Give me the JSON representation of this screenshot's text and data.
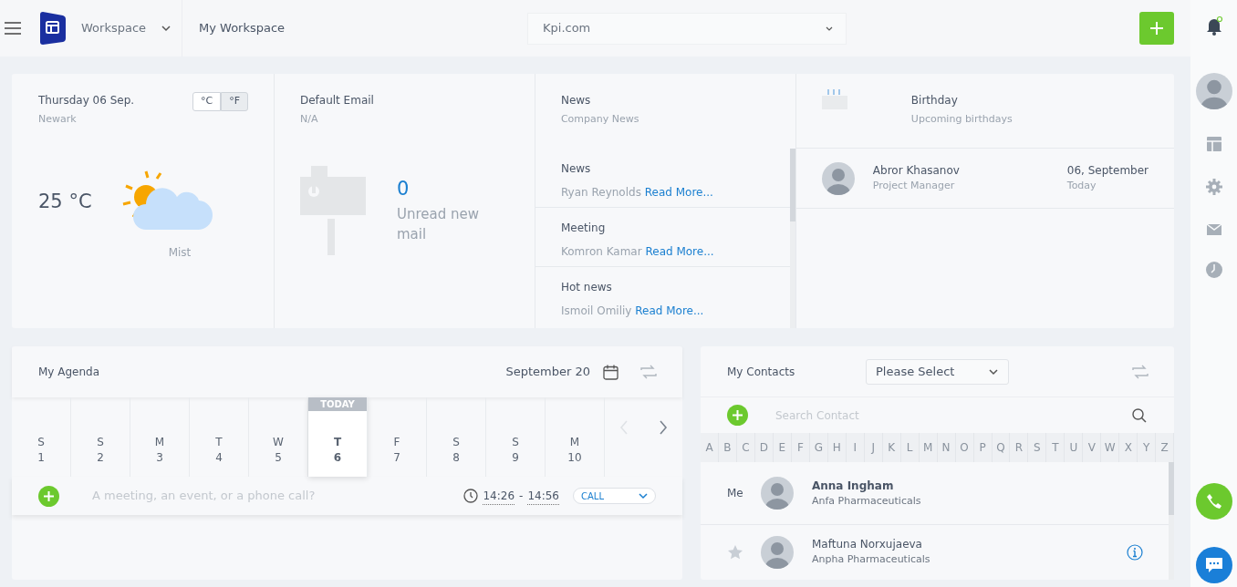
{
  "header": {
    "workspace": "Workspace",
    "page_title": "My Workspace",
    "domain": "Kpi.com"
  },
  "weather": {
    "date": "Thursday 06 Sep.",
    "city": "Newark",
    "units": [
      {
        "label": "°C",
        "selected": false
      },
      {
        "label": "°F",
        "selected": true
      }
    ],
    "temperature": "25 °C",
    "condition": "Mist"
  },
  "email": {
    "title": "Default Email",
    "address": "N/A",
    "count": "0",
    "caption": "Unread new mail"
  },
  "news": {
    "title": "News",
    "subtitle": "Company News",
    "items": [
      {
        "title": "News",
        "author": "Ryan Reynolds",
        "link": "Read More..."
      },
      {
        "title": "Meeting",
        "author": "Komron Kamar",
        "link": "Read More..."
      },
      {
        "title": "Hot news",
        "author": "Ismoil Omiliy",
        "link": "Read More..."
      }
    ]
  },
  "birthday": {
    "title": "Birthday",
    "subtitle": "Upcoming birthdays",
    "people": [
      {
        "name": "Abror Khasanov",
        "role": "Project Manager",
        "date": "06, September",
        "when": "Today"
      }
    ]
  },
  "agenda": {
    "title": "My Agenda",
    "month": "September 20",
    "today_label": "TODAY",
    "days": [
      {
        "weekday": "S",
        "day": "1",
        "selected": false
      },
      {
        "weekday": "S",
        "day": "2",
        "selected": false
      },
      {
        "weekday": "M",
        "day": "3",
        "selected": false
      },
      {
        "weekday": "T",
        "day": "4",
        "selected": false
      },
      {
        "weekday": "W",
        "day": "5",
        "selected": false
      },
      {
        "weekday": "T",
        "day": "6",
        "selected": true
      },
      {
        "weekday": "F",
        "day": "7",
        "selected": false
      },
      {
        "weekday": "S",
        "day": "8",
        "selected": false
      },
      {
        "weekday": "S",
        "day": "9",
        "selected": false
      },
      {
        "weekday": "M",
        "day": "10",
        "selected": false
      }
    ],
    "placeholder": "A meeting, an event, or a phone call?",
    "time_from": "14:26",
    "time_separator": "-",
    "time_to": "14:56",
    "type": "CALL"
  },
  "contacts": {
    "title": "My Contacts",
    "filter": "Please Select",
    "search_placeholder": "Search Contact",
    "letters": [
      "A",
      "B",
      "C",
      "D",
      "E",
      "F",
      "G",
      "H",
      "I",
      "J",
      "K",
      "L",
      "M",
      "N",
      "O",
      "P",
      "Q",
      "R",
      "S",
      "T",
      "U",
      "V",
      "W",
      "X",
      "Y",
      "Z"
    ],
    "items": [
      {
        "kind": "self",
        "label": "Me",
        "name": "Anna Ingham",
        "company": "Anfa Pharmaceuticals"
      },
      {
        "kind": "favorite",
        "name": "Maftuna Norxujaeva",
        "company": "Anpha Pharmaceuticals"
      }
    ]
  }
}
